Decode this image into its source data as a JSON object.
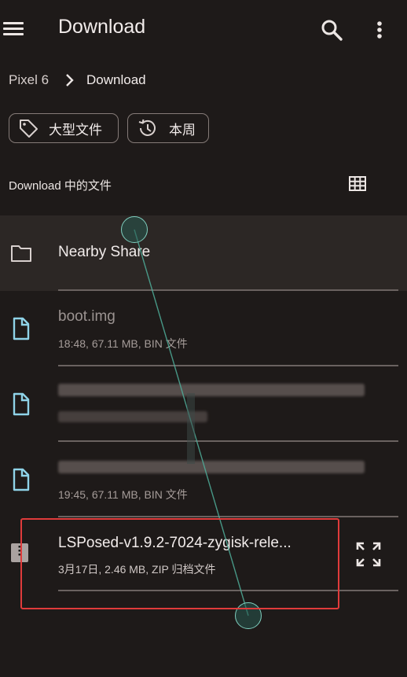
{
  "topbar": {
    "menu_icon": "menu-icon",
    "title": "Download",
    "search_icon": "search-icon",
    "more_icon": "more-vert-icon"
  },
  "breadcrumb": {
    "root": "Pixel 6",
    "separator_icon": "chevron-right-icon",
    "current": "Download"
  },
  "chips": [
    {
      "label": "大型文件",
      "icon": "label-tag-icon"
    },
    {
      "label": "本周",
      "icon": "history-icon"
    }
  ],
  "section": {
    "title": "Download 中的文件",
    "view_toggle_icon": "grid-view-icon"
  },
  "files": [
    {
      "name": "Nearby Share",
      "meta": "",
      "icon": "folder-icon",
      "type": "folder"
    },
    {
      "name": "boot.img",
      "meta": "18:48, 67.11 MB, BIN 文件",
      "icon": "file-icon",
      "type": "file"
    },
    {
      "name": "",
      "meta": "",
      "icon": "file-icon",
      "type": "file",
      "obscured": true
    },
    {
      "name": "",
      "meta": "19:45, 67.11 MB, BIN 文件",
      "icon": "file-icon",
      "type": "file",
      "obscured_name": true
    },
    {
      "name": "LSPosed-v1.9.2-7024-zygisk-rele...",
      "meta": "3月17日, 2.46 MB, ZIP 归档文件",
      "icon": "archive-icon",
      "type": "zip",
      "action_icon": "expand-icon"
    }
  ],
  "colors": {
    "background": "#1e1a19",
    "file_icon": "#8fd3e8",
    "highlight": "#e03b3b",
    "touch_indicator": "#7fcfbf"
  }
}
